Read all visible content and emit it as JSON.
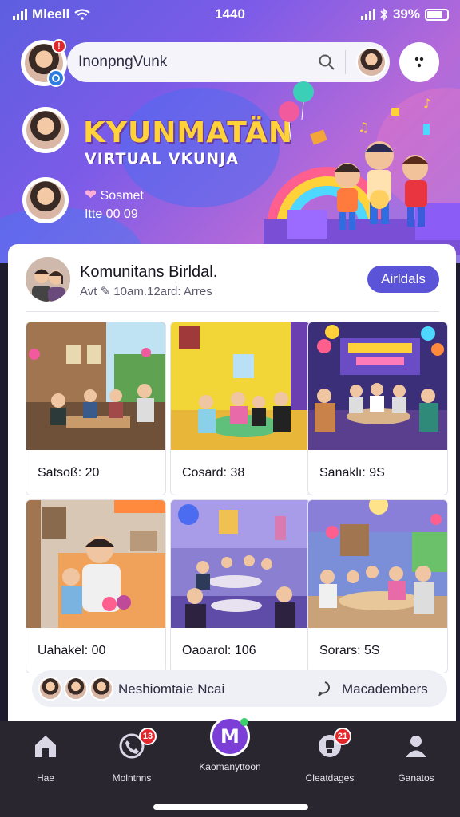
{
  "status_bar": {
    "carrier": "Mleell",
    "time": "1440",
    "battery": "39%"
  },
  "search": {
    "value": "InonpngVunk",
    "avatar_badge": ""
  },
  "hero": {
    "title": "KYUNMATÄN",
    "subtitle": "VIRTUAL VKUNJA",
    "line1": "Sosmet",
    "line2": "Itte 00 09"
  },
  "group": {
    "name": "Komunitans Birldal.",
    "meta": "Avt ✎ 10am.12ard: Arres",
    "join_label": "Airldals"
  },
  "tiles": [
    {
      "caption": "Satsoß: 20"
    },
    {
      "caption": "Cosard: 38"
    },
    {
      "caption": "Sanaklı: 9S"
    },
    {
      "caption": "Uahakel: 00"
    },
    {
      "caption": "Oaoarol: 106"
    },
    {
      "caption": "Sorars: 5S"
    }
  ],
  "strip": {
    "left_text": "Neshiomtaie Ncai",
    "right_text": "Macadembers"
  },
  "tabs": [
    {
      "label": "Hae",
      "badge": ""
    },
    {
      "label": "Molntnns",
      "badge": "13"
    },
    {
      "label": "Kaomanyttoon",
      "badge": ""
    },
    {
      "label": "Cleatdages",
      "badge": "21"
    },
    {
      "label": "Ganatos",
      "badge": ""
    }
  ],
  "colors": {
    "accent": "#5b53d8",
    "title_yellow": "#ffd23a",
    "badge_red": "#e3262b",
    "tabbar": "#2a2630"
  }
}
